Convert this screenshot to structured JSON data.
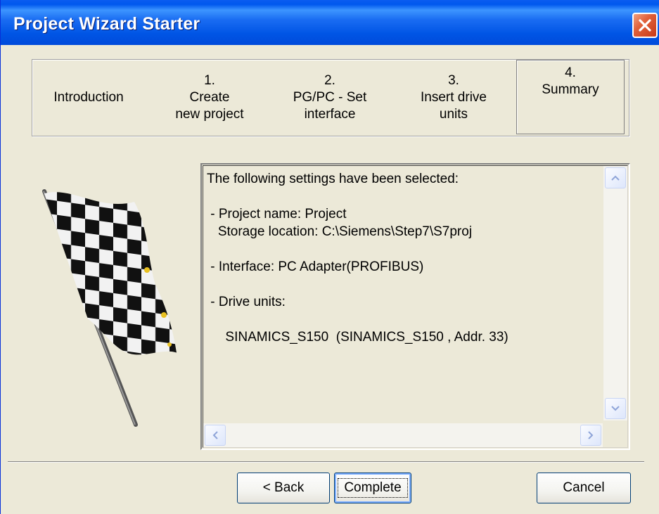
{
  "window": {
    "title": "Project Wizard Starter"
  },
  "steps": [
    {
      "number": "",
      "lines": [
        "Introduction"
      ]
    },
    {
      "number": "1.",
      "lines": [
        "Create",
        "new project"
      ]
    },
    {
      "number": "2.",
      "lines": [
        "PG/PC - Set",
        "interface"
      ]
    },
    {
      "number": "3.",
      "lines": [
        "Insert drive",
        "units"
      ]
    },
    {
      "number": "4.",
      "lines": [
        "Summary"
      ],
      "active": true
    }
  ],
  "summary": {
    "heading": "The following settings have been selected:",
    "project_name": " - Project name: Project",
    "storage_location": "   Storage location: C:\\Siemens\\Step7\\S7proj",
    "interface": " - Interface: PC Adapter(PROFIBUS)",
    "drive_units": " - Drive units:",
    "drive_entry": "     SINAMICS_S150  (SINAMICS_S150 , Addr. 33)"
  },
  "buttons": {
    "back": "< Back",
    "complete": "Complete",
    "cancel": "Cancel"
  },
  "icons": {
    "close": "close-icon",
    "flag": "checkered-flag-icon"
  },
  "colors": {
    "titlebar": "#0058ee",
    "close": "#e0603a",
    "face": "#ece9d8"
  }
}
